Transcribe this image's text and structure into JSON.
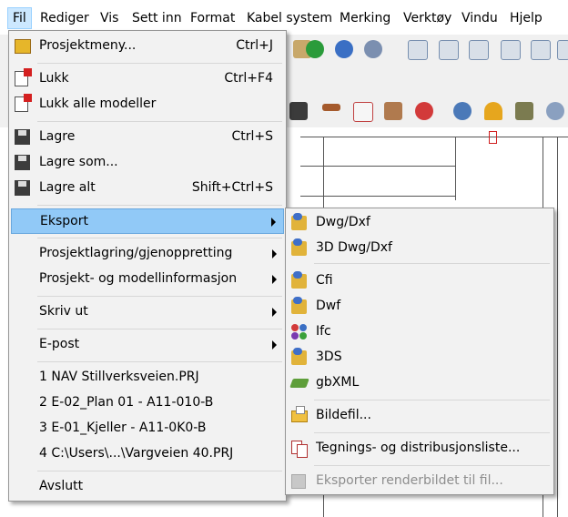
{
  "menubar": {
    "items": [
      "Fil",
      "Rediger",
      "Vis",
      "Sett inn",
      "Format",
      "Kabel system",
      "Merking",
      "Verktøy",
      "Vindu",
      "Hjelp"
    ]
  },
  "file_menu": {
    "items": [
      {
        "label": "Prosjektmeny...",
        "shortcut": "Ctrl+J",
        "icon": "project-menu-icon"
      },
      {
        "label": "Lukk",
        "shortcut": "Ctrl+F4",
        "icon": "close-model-icon"
      },
      {
        "label": "Lukk alle modeller",
        "shortcut": "",
        "icon": "close-all-models-icon"
      },
      {
        "label": "Lagre",
        "shortcut": "Ctrl+S",
        "icon": "save-icon"
      },
      {
        "label": "Lagre som...",
        "shortcut": "",
        "icon": "save-as-icon"
      },
      {
        "label": "Lagre alt",
        "shortcut": "Shift+Ctrl+S",
        "icon": "save-all-icon"
      },
      {
        "label": "Eksport",
        "shortcut": "",
        "submenu": true
      },
      {
        "label": "Prosjektlagring/gjenoppretting",
        "shortcut": "",
        "submenu": true
      },
      {
        "label": "Prosjekt- og modellinformasjon",
        "shortcut": "",
        "submenu": true
      },
      {
        "label": "Skriv ut",
        "shortcut": "",
        "submenu": true
      },
      {
        "label": "E-post",
        "shortcut": "",
        "submenu": true
      },
      {
        "label": "1 NAV Stillverksveien.PRJ",
        "shortcut": ""
      },
      {
        "label": "2 E-02_Plan 01 - A11-010-B",
        "shortcut": ""
      },
      {
        "label": "3 E-01_Kjeller - A11-0K0-B",
        "shortcut": ""
      },
      {
        "label": "4 C:\\Users\\...\\Vargveien 40.PRJ",
        "shortcut": ""
      },
      {
        "label": "Avslutt",
        "shortcut": ""
      }
    ]
  },
  "export_menu": {
    "items": [
      {
        "label": "Dwg/Dxf",
        "icon": "dwg-dxf-icon",
        "disabled": false
      },
      {
        "label": "3D Dwg/Dxf",
        "icon": "3d-dwg-dxf-icon",
        "disabled": false
      },
      {
        "label": "Cfi",
        "icon": "cfi-icon",
        "disabled": false
      },
      {
        "label": "Dwf",
        "icon": "dwf-icon",
        "disabled": false
      },
      {
        "label": "Ifc",
        "icon": "ifc-icon",
        "disabled": false
      },
      {
        "label": "3DS",
        "icon": "3ds-icon",
        "disabled": false
      },
      {
        "label": "gbXML",
        "icon": "gbxml-icon",
        "disabled": false
      },
      {
        "label": "Bildefil...",
        "icon": "image-file-icon",
        "disabled": false
      },
      {
        "label": "Tegnings- og distribusjonsliste...",
        "icon": "drawing-list-icon",
        "disabled": false
      },
      {
        "label": "Eksporter renderbildet til fil...",
        "icon": "render-export-icon",
        "disabled": true
      }
    ]
  },
  "colors": {
    "highlight": "#91c9f7",
    "menu_bg": "#f2f2f2",
    "disabled": "#8d8d8d"
  }
}
